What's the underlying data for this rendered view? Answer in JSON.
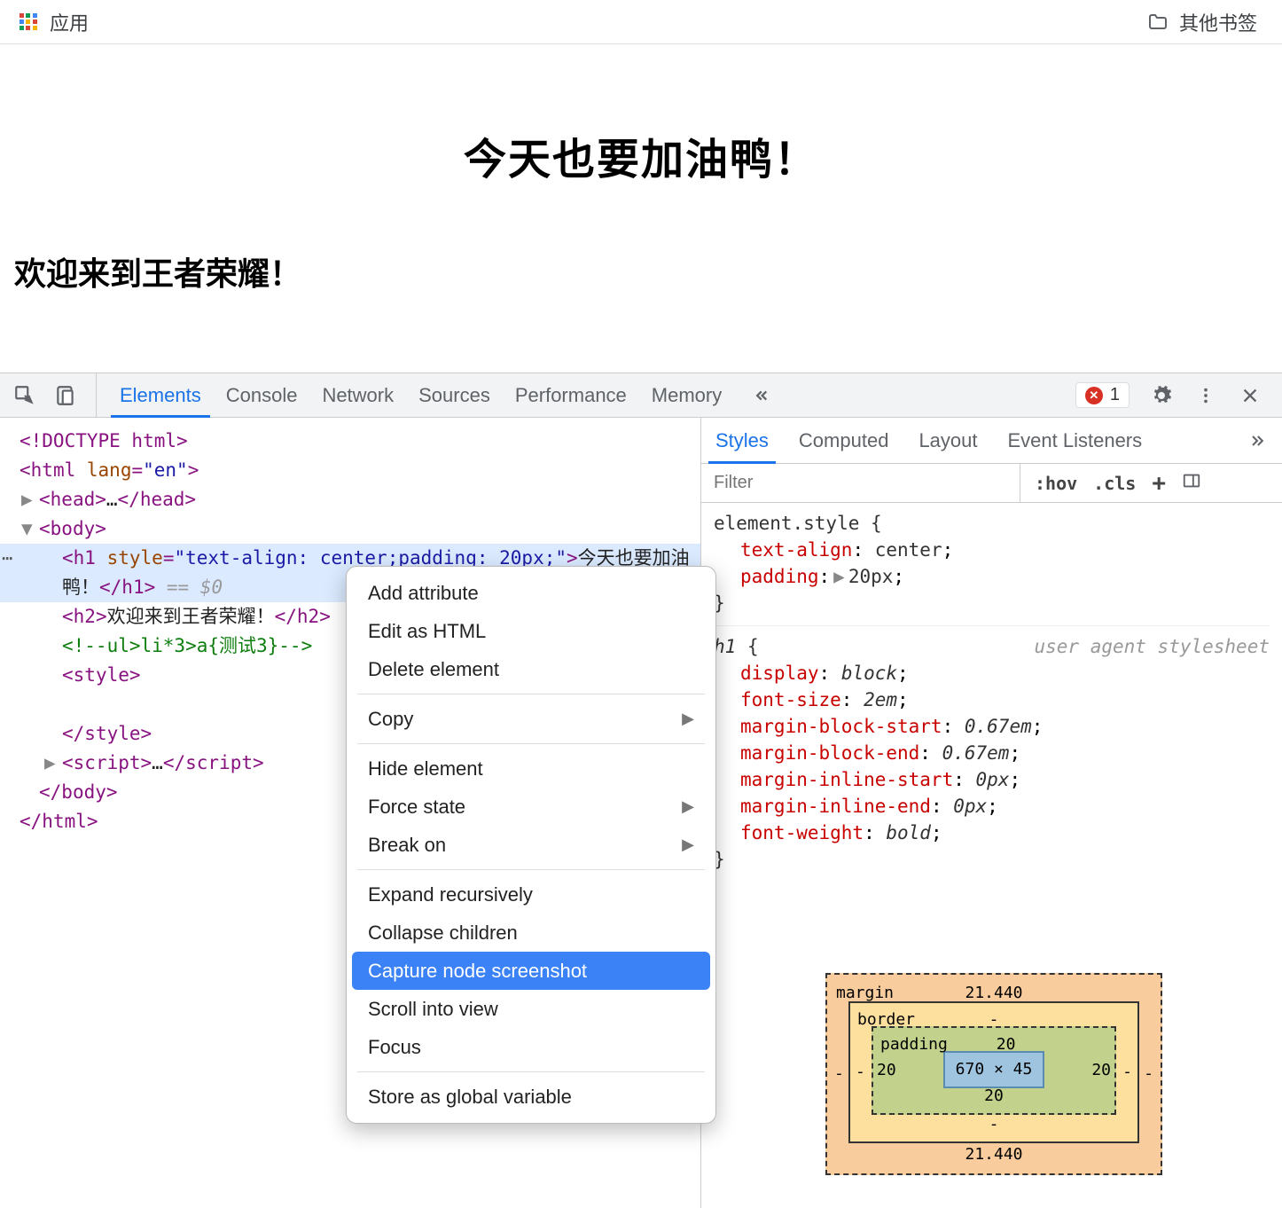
{
  "bookmarks": {
    "apps_label": "应用",
    "other_label": "其他书签"
  },
  "page": {
    "h1": "今天也要加油鸭！",
    "h2": "欢迎来到王者荣耀！"
  },
  "devtools": {
    "tabs": [
      "Elements",
      "Console",
      "Network",
      "Sources",
      "Performance",
      "Memory"
    ],
    "error_count": "1",
    "styles_tabs": [
      "Styles",
      "Computed",
      "Layout",
      "Event Listeners"
    ],
    "filter_placeholder": "Filter",
    "hov": ":hov",
    "cls": ".cls"
  },
  "dom": {
    "doctype": "<!DOCTYPE html>",
    "html_open": "html",
    "html_lang_attr": "lang",
    "html_lang_val": "\"en\"",
    "head": "head",
    "body": "body",
    "h1_tag": "h1",
    "h1_style_attr": "style",
    "h1_style_val": "\"text-align: center;padding: 20px;\"",
    "h1_text": "今天也要加油鸭！",
    "eq0": "== $0",
    "h2_tag": "h2",
    "h2_text": "欢迎来到王者荣耀！",
    "comment": "<!--ul>li*3>a{测试3}-->",
    "style_tag": "style",
    "script_tag": "script",
    "html_close": "/html"
  },
  "ctx": {
    "add_attr": "Add attribute",
    "edit_html": "Edit as HTML",
    "delete": "Delete element",
    "copy": "Copy",
    "hide": "Hide element",
    "force": "Force state",
    "break": "Break on",
    "expand": "Expand recursively",
    "collapse": "Collapse children",
    "capture": "Capture node screenshot",
    "scroll": "Scroll into view",
    "focus": "Focus",
    "store": "Store as global variable"
  },
  "styles_panel": {
    "element_style": "element.style",
    "es_props": [
      {
        "name": "text-align",
        "val": "center"
      },
      {
        "name": "padding",
        "val": "20px",
        "tri": true
      }
    ],
    "h1_sel": "h1",
    "ua_note": "user agent stylesheet",
    "h1_props": [
      {
        "name": "display",
        "val": "block"
      },
      {
        "name": "font-size",
        "val": "2em"
      },
      {
        "name": "margin-block-start",
        "val": "0.67em"
      },
      {
        "name": "margin-block-end",
        "val": "0.67em"
      },
      {
        "name": "margin-inline-start",
        "val": "0px"
      },
      {
        "name": "margin-inline-end",
        "val": "0px"
      },
      {
        "name": "font-weight",
        "val": "bold"
      }
    ]
  },
  "box_model": {
    "margin_label": "margin",
    "margin_top": "21.440",
    "margin_right": "-",
    "margin_bottom": "21.440",
    "margin_left": "-",
    "border_label": "border",
    "border_val": "-",
    "padding_label": "padding",
    "padding_top": "20",
    "padding_right": "20",
    "padding_bottom": "20",
    "padding_left": "20",
    "content": "670 × 45"
  }
}
